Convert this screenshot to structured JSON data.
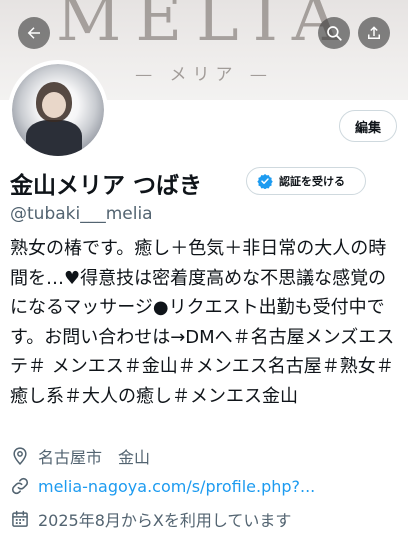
{
  "banner": {
    "word": "MELIA",
    "sub": "— メリア —"
  },
  "header_buttons": {
    "back_icon": "arrow-left-icon",
    "search_icon": "search-icon",
    "share_icon": "share-icon"
  },
  "profile": {
    "edit_label": "編集",
    "display_name": "金山メリア つばき",
    "verify_label": "認証を受ける",
    "handle": "@tubaki___melia",
    "bio": "熟女の椿です。癒し＋色気＋非日常の大人の時間を…♥得意技は密着度高めな不思議な感覚のになるマッサージ●リクエスト出勤も受付中です。お問い合わせは→DMへ＃名古屋メンズエステ＃ メンエス＃金山＃メンエス名古屋＃熟女＃ 癒し系＃大人の癒し＃メンエス金山",
    "location": "名古屋市　金山",
    "website": "melia-nagoya.com/s/profile.php?...",
    "joined": "2025年8月からXを利用しています"
  },
  "colors": {
    "link": "#1d9bf0",
    "muted": "#536471",
    "text": "#0f1419",
    "verify_badge": "#1d9bf0"
  }
}
